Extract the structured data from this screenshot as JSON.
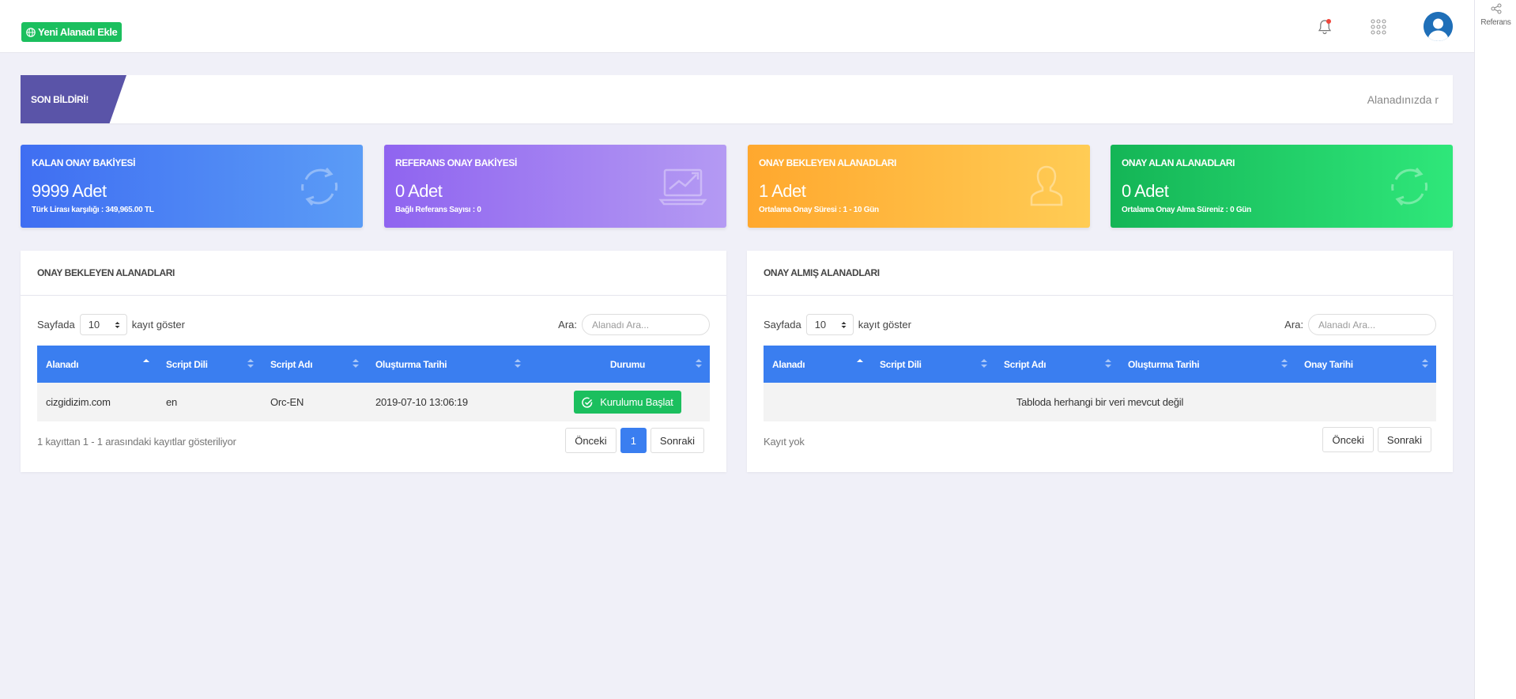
{
  "topbar": {
    "add_domain_label": "Yeni Alanadı Ekle"
  },
  "sidepanel": {
    "referans_label": "Referans"
  },
  "announcement": {
    "label": "SON BİLDİRİ!",
    "text": "Alanadınızda r"
  },
  "stats": [
    {
      "title": "KALAN ONAY BAKİYESİ",
      "value": "9999 Adet",
      "sub": "Türk Lirası karşılığı : 349,965.00 TL",
      "icon": "refresh-icon",
      "color": "#3f6ef2"
    },
    {
      "title": "REFERANS ONAY BAKİYESİ",
      "value": "0 Adet",
      "sub": "Bağlı Referans Sayısı : 0",
      "icon": "laptop-chart-icon",
      "color": "#8f64f0"
    },
    {
      "title": "ONAY BEKLEYEN ALANADLARI",
      "value": "1 Adet",
      "sub": "Ortalama Onay Süresi : 1 - 10 Gün",
      "icon": "user-icon",
      "color": "#ffa82e"
    },
    {
      "title": "ONAY ALAN ALANADLARI",
      "value": "0 Adet",
      "sub": "Ortalama Onay Alma Süreniz : 0 Gün",
      "icon": "refresh-icon",
      "color": "#14b556"
    }
  ],
  "pending": {
    "title": "ONAY BEKLEYEN ALANADLARI",
    "length_prefix": "Sayfada",
    "length_value": "10",
    "length_suffix": "kayıt göster",
    "search_label": "Ara:",
    "search_placeholder": "Alanadı Ara...",
    "columns": [
      "Alanadı",
      "Script Dili",
      "Script Adı",
      "Oluşturma Tarihi",
      "Durumu"
    ],
    "rows": [
      {
        "domain": "cizgidizim.com",
        "lang": "en",
        "script": "Orc-EN",
        "created": "2019-07-10 13:06:19",
        "action": "Kurulumu Başlat"
      }
    ],
    "info": "1 kayıttan 1 - 1 arasındaki kayıtlar gösteriliyor",
    "prev_label": "Önceki",
    "page": "1",
    "next_label": "Sonraki"
  },
  "approved": {
    "title": "ONAY ALMIŞ ALANADLARI",
    "length_prefix": "Sayfada",
    "length_value": "10",
    "length_suffix": "kayıt göster",
    "search_label": "Ara:",
    "search_placeholder": "Alanadı Ara...",
    "columns": [
      "Alanadı",
      "Script Dili",
      "Script Adı",
      "Oluşturma Tarihi",
      "Onay Tarihi"
    ],
    "empty_text": "Tabloda herhangi bir veri mevcut değil",
    "info": "Kayıt yok",
    "prev_label": "Önceki",
    "next_label": "Sonraki"
  }
}
